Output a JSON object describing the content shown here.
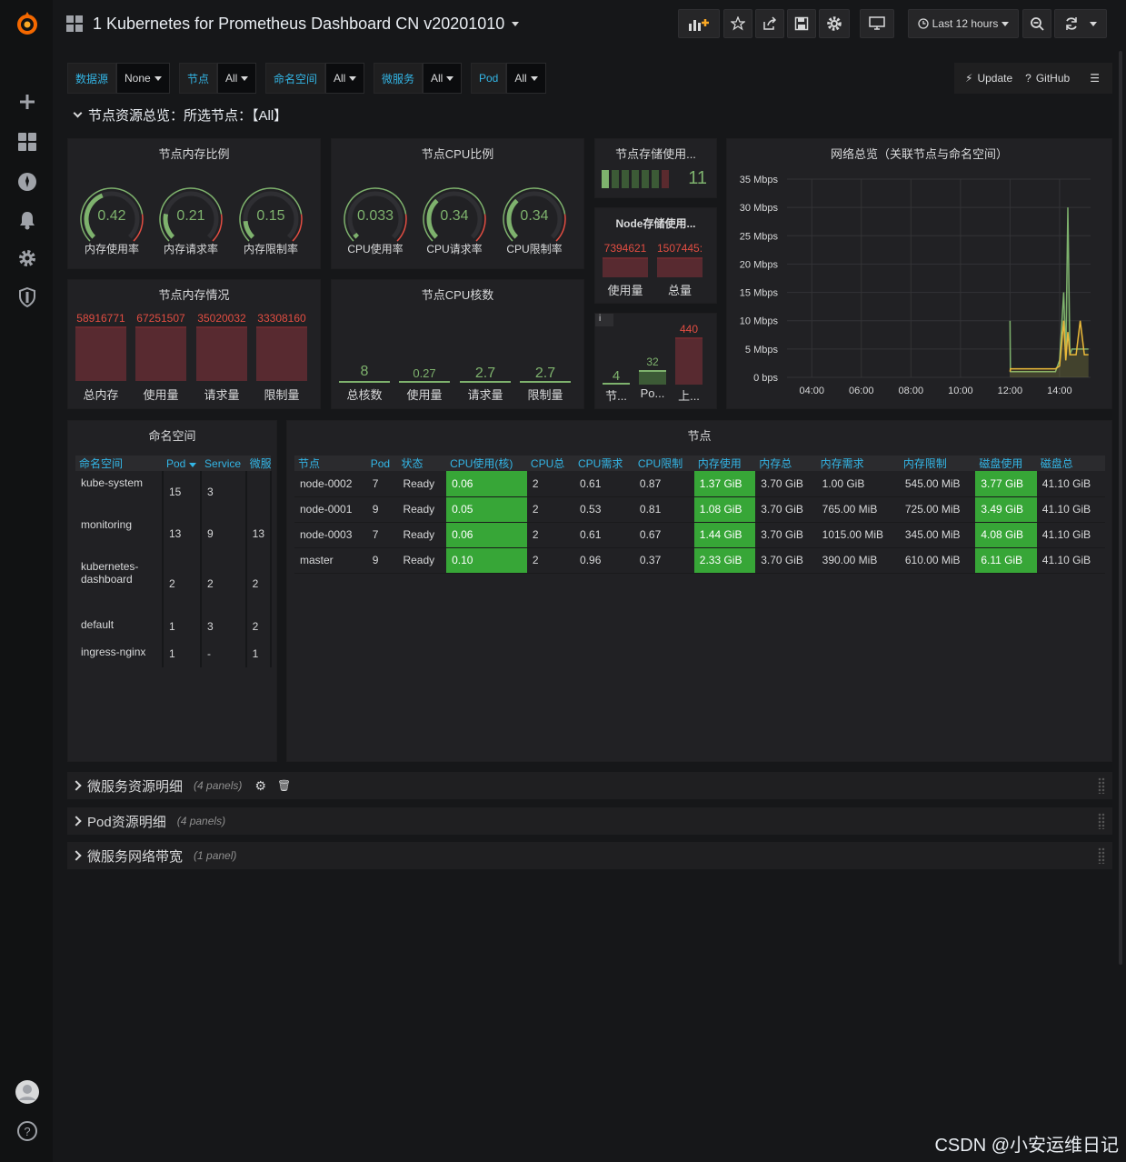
{
  "header": {
    "title": "1 Kubernetes for Prometheus Dashboard CN v20201010",
    "time_range": "Last 12 hours"
  },
  "variables": [
    {
      "label": "数据源",
      "value": "None"
    },
    {
      "label": "节点",
      "value": "All"
    },
    {
      "label": "命名空间",
      "value": "All"
    },
    {
      "label": "微服务",
      "value": "All"
    },
    {
      "label": "Pod",
      "value": "All"
    }
  ],
  "links": {
    "update": "Update",
    "github": "GitHub"
  },
  "row1": {
    "title": "节点资源总览：所选节点：【All】"
  },
  "mem_ratio": {
    "title": "节点内存比例",
    "gauges": [
      {
        "value": "0.42",
        "label": "内存使用率",
        "fraction": 0.42
      },
      {
        "value": "0.21",
        "label": "内存请求率",
        "fraction": 0.21
      },
      {
        "value": "0.15",
        "label": "内存限制率",
        "fraction": 0.15
      }
    ]
  },
  "cpu_ratio": {
    "title": "节点CPU比例",
    "gauges": [
      {
        "value": "0.033",
        "label": "CPU使用率",
        "fraction": 0.033
      },
      {
        "value": "0.34",
        "label": "CPU请求率",
        "fraction": 0.34
      },
      {
        "value": "0.34",
        "label": "CPU限制率",
        "fraction": 0.34
      }
    ]
  },
  "storage": {
    "title": "节点存储使用...",
    "value": "11"
  },
  "node_storage": {
    "title": "Node存储使用...",
    "used_value": "7394621",
    "total_value": "1507445:",
    "used_label": "使用量",
    "total_label": "总量"
  },
  "pods_panel": {
    "info": "i",
    "items": [
      {
        "value": "4",
        "label": "节..."
      },
      {
        "value": "32",
        "label": "Po..."
      },
      {
        "value": "440",
        "label": "上..."
      }
    ]
  },
  "mem_status": {
    "title": "节点内存情况",
    "bars": [
      {
        "value": "58916771",
        "label": "总内存"
      },
      {
        "value": "67251507",
        "label": "使用量"
      },
      {
        "value": "35020032",
        "label": "请求量"
      },
      {
        "value": "33308160",
        "label": "限制量"
      }
    ]
  },
  "cpu_cores": {
    "title": "节点CPU核数",
    "items": [
      {
        "value": "8",
        "label": "总核数"
      },
      {
        "value": "0.27",
        "label": "使用量"
      },
      {
        "value": "2.7",
        "label": "请求量"
      },
      {
        "value": "2.7",
        "label": "限制量"
      }
    ]
  },
  "network": {
    "title": "网络总览（关联节点与命名空间）",
    "y_ticks": [
      "35 Mbps",
      "30 Mbps",
      "25 Mbps",
      "20 Mbps",
      "15 Mbps",
      "10 Mbps",
      "5 Mbps",
      "0 bps"
    ],
    "x_ticks": [
      "04:00",
      "06:00",
      "08:00",
      "10:00",
      "12:00",
      "14:00"
    ]
  },
  "chart_data": {
    "type": "line",
    "title": "网络总览（关联节点与命名空间）",
    "ylim": [
      0,
      35
    ],
    "x": [
      "03:00",
      "12:00",
      "12:01",
      "13:50",
      "14:00",
      "14:10",
      "14:15",
      "14:20",
      "14:25",
      "14:30",
      "14:40",
      "14:50",
      "15:00",
      "15:10"
    ],
    "series": [
      {
        "color": "#7eb26d",
        "values": [
          null,
          10,
          1,
          1,
          3,
          15,
          3,
          30,
          4,
          5,
          5,
          5,
          5,
          5
        ]
      },
      {
        "color": "#eab839",
        "values": [
          null,
          1,
          1.5,
          1.5,
          2,
          10,
          3,
          8,
          4,
          4,
          4,
          10,
          4,
          4
        ]
      }
    ]
  },
  "ns_panel": {
    "title": "命名空间",
    "headers": [
      "命名空间",
      "Pod",
      "Service",
      "微服务"
    ],
    "rows": [
      [
        "kube-system",
        "15",
        "3",
        ""
      ],
      [
        "monitoring",
        "13",
        "9",
        "13"
      ],
      [
        "kubernetes-dashboard",
        "2",
        "2",
        "2"
      ],
      [
        "default",
        "1",
        "3",
        "2"
      ],
      [
        "ingress-nginx",
        "1",
        "-",
        "1"
      ]
    ]
  },
  "nodes_panel": {
    "title": "节点",
    "headers": [
      "节点",
      "Pod",
      "状态",
      "CPU使用(核)",
      "CPU总",
      "CPU需求",
      "CPU限制",
      "内存使用",
      "内存总",
      "内存需求",
      "内存限制",
      "磁盘使用",
      "磁盘总"
    ],
    "rows": [
      [
        "node-0002",
        "7",
        "Ready",
        "0.06",
        "2",
        "0.61",
        "0.87",
        "1.37 GiB",
        "3.70 GiB",
        "1.00 GiB",
        "545.00 MiB",
        "3.77 GiB",
        "41.10 GiB"
      ],
      [
        "node-0001",
        "9",
        "Ready",
        "0.05",
        "2",
        "0.53",
        "0.81",
        "1.08 GiB",
        "3.70 GiB",
        "765.00 MiB",
        "725.00 MiB",
        "3.49 GiB",
        "41.10 GiB"
      ],
      [
        "node-0003",
        "7",
        "Ready",
        "0.06",
        "2",
        "0.61",
        "0.67",
        "1.44 GiB",
        "3.70 GiB",
        "1015.00 MiB",
        "345.00 MiB",
        "4.08 GiB",
        "41.10 GiB"
      ],
      [
        "master",
        "9",
        "Ready",
        "0.10",
        "2",
        "0.96",
        "0.37",
        "2.33 GiB",
        "3.70 GiB",
        "390.00 MiB",
        "610.00 MiB",
        "6.11 GiB",
        "41.10 GiB"
      ]
    ]
  },
  "rows": [
    {
      "title": "微服务资源明细",
      "sub": "(4 panels)"
    },
    {
      "title": "Pod资源明细",
      "sub": "(4 panels)"
    },
    {
      "title": "微服务网络带宽",
      "sub": "(1 panel)"
    }
  ],
  "watermark": "CSDN @小安运维日记",
  "colors": {
    "accent": "#33b5e5",
    "green": "#7eb26d",
    "red": "#e24d42",
    "yellow": "#eab839"
  }
}
